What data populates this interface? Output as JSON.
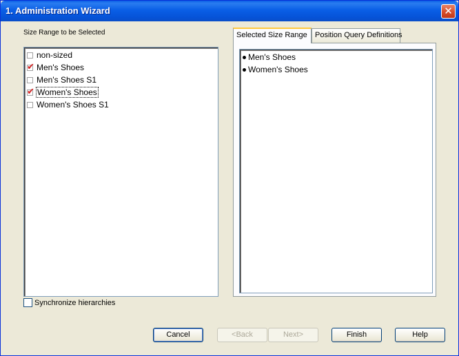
{
  "window": {
    "title": "1. Administration Wizard",
    "close_glyph": "✕"
  },
  "left": {
    "label": "Size Range to be Selected",
    "items": [
      {
        "label": "non-sized",
        "checked": false
      },
      {
        "label": "Men's Shoes",
        "checked": true
      },
      {
        "label": "Men's Shoes S1",
        "checked": false
      },
      {
        "label": "Women's Shoes",
        "checked": true,
        "focused": true
      },
      {
        "label": "Women's Shoes S1",
        "checked": false
      }
    ],
    "sync_label": "Synchronize hierarchies"
  },
  "tabs": [
    {
      "label": "Selected Size Range",
      "active": true
    },
    {
      "label": "Position Query Definitions",
      "active": false
    }
  ],
  "selected_items": [
    "Men's Shoes",
    "Women's Shoes"
  ],
  "buttons": {
    "cancel": "Cancel",
    "back": "<Back",
    "next": "Next>",
    "finish": "Finish",
    "help": "Help"
  },
  "icons": {
    "check": "check-icon",
    "bullet": "bullet-icon",
    "close": "close-icon"
  }
}
